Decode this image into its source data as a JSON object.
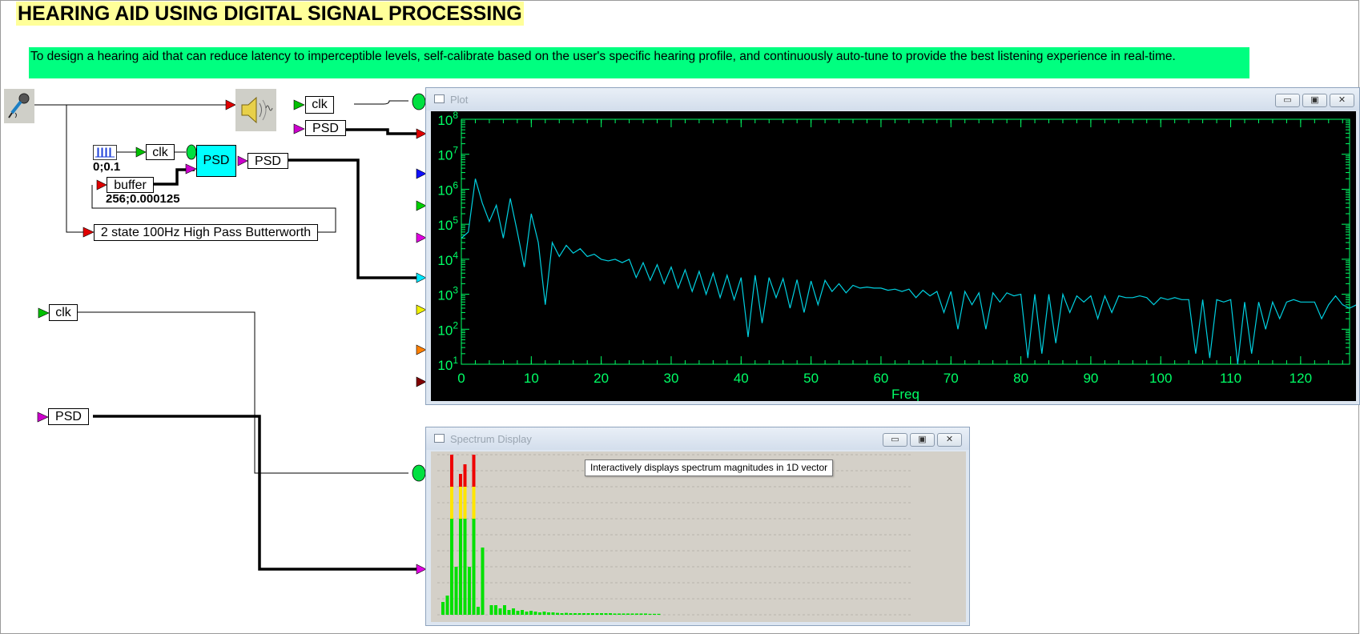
{
  "title": "HEARING AID USING DIGITAL SIGNAL PROCESSING",
  "description": "To design a hearing aid that can reduce latency to imperceptible levels, self-calibrate based on the user's specific hearing profile, and continuously auto-tune to provide the best listening experience in real-time.",
  "blocks": {
    "clk_top": "clk",
    "psd_top": "PSD",
    "clk_mid": "clk",
    "psd_block": "PSD",
    "psd_out": "PSD",
    "buffer": "buffer",
    "filter": "2 state 100Hz High Pass Butterworth",
    "clk_left": "clk",
    "psd_left": "PSD"
  },
  "params": {
    "pulse_params": "0;0.1",
    "buffer_params": "256;0.000125"
  },
  "plot_window": {
    "title": "Plot",
    "chart_data": {
      "type": "line",
      "xlabel": "Freq",
      "ylabel": "",
      "xlim": [
        0,
        127
      ],
      "ylim": [
        10,
        100000000
      ],
      "yscale": "log",
      "x_ticks": [
        0,
        10,
        20,
        30,
        40,
        50,
        60,
        70,
        80,
        90,
        100,
        110,
        120
      ],
      "y_tick_labels": [
        "10^1",
        "10^2",
        "10^3",
        "10^4",
        "10^5",
        "10^6",
        "10^7",
        "10^8"
      ],
      "y_tick_bases": [
        "10",
        "10",
        "10",
        "10",
        "10",
        "10",
        "10",
        "10"
      ],
      "y_tick_exps": [
        "1",
        "2",
        "3",
        "4",
        "5",
        "6",
        "7",
        "8"
      ],
      "colors": {
        "background": "#000000",
        "axis": "#00ff66",
        "line": "#00d0e0"
      },
      "series": [
        {
          "values": [
            40000,
            60000,
            2000000,
            400000,
            120000,
            350000,
            40000,
            550000,
            60000,
            6000,
            200000,
            30000,
            500,
            30000,
            12000,
            25000,
            15000,
            20000,
            12000,
            14000,
            10000,
            9000,
            10000,
            8000,
            10000,
            3000,
            8000,
            2500,
            7000,
            2000,
            6000,
            1500,
            5000,
            1200,
            4500,
            1000,
            4000,
            800,
            3500,
            700,
            3000,
            60,
            3500,
            150,
            3000,
            800,
            2800,
            400,
            2600,
            300,
            2400,
            500,
            2500,
            1200,
            2000,
            1100,
            1800,
            1500,
            1600,
            1500,
            1500,
            1300,
            1400,
            1200,
            1400,
            800,
            1300,
            900,
            1200,
            300,
            1200,
            100,
            1200,
            500,
            1100,
            100,
            1100,
            600,
            1100,
            900,
            1000,
            15,
            1000,
            20,
            1000,
            40,
            1000,
            300,
            900,
            600,
            900,
            200,
            900,
            300,
            900,
            800,
            800,
            900,
            800,
            500,
            800,
            700,
            800,
            700,
            700,
            20,
            700,
            15,
            700,
            600,
            700,
            10,
            600,
            20,
            600,
            100,
            600,
            200,
            600,
            700,
            600,
            600,
            600,
            200,
            500,
            900,
            500,
            400,
            500,
            200,
            500,
            700,
            500,
            500,
            500,
            600,
            500,
            500,
            500,
            200,
            1000,
            25
          ]
        }
      ]
    }
  },
  "spectrum_window": {
    "title": "Spectrum Display",
    "tooltip": "Interactively displays spectrum magnitudes in 1D vector",
    "chart_data": {
      "type": "bar",
      "ylim": [
        0,
        1
      ],
      "colors": {
        "background": "#d4d0c8",
        "low": "#00e000",
        "mid": "#ffe600",
        "high": "#ee0000"
      },
      "values": [
        0.08,
        0.12,
        1.0,
        0.3,
        0.88,
        0.94,
        0.3,
        1.0,
        0.05,
        0.42,
        0.0,
        0.06,
        0.06,
        0.04,
        0.06,
        0.03,
        0.04,
        0.025,
        0.03,
        0.02,
        0.025,
        0.02,
        0.015,
        0.02,
        0.015,
        0.015,
        0.012,
        0.01,
        0.012,
        0.01,
        0.01,
        0.01,
        0.01,
        0.01,
        0.01,
        0.01,
        0.01,
        0.01,
        0.01,
        0.008,
        0.008,
        0.008,
        0.008,
        0.008,
        0.008,
        0.008,
        0.008,
        0.006,
        0.006,
        0.006
      ]
    }
  },
  "window_buttons": {
    "minimize": "▭",
    "maximize": "▣",
    "close": "✕"
  }
}
